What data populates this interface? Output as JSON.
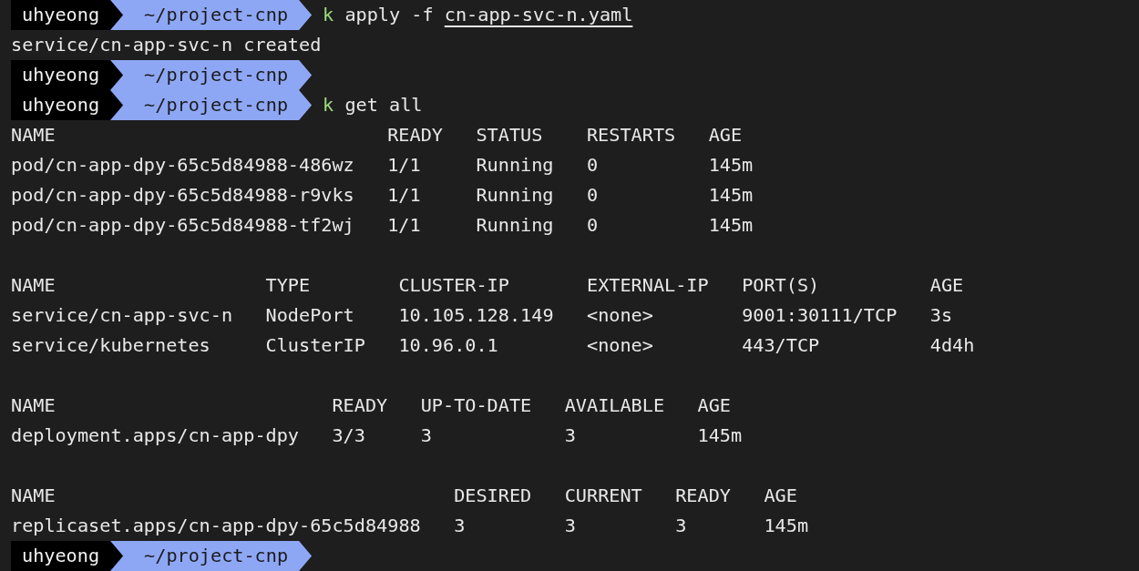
{
  "lines": [
    {
      "kind": "prompt",
      "user": "uhyeong",
      "path": "~/project-cnp",
      "command": "k",
      "args": [
        {
          "text": "apply -f",
          "underline": false
        },
        {
          "text": "cn-app-svc-n.yaml",
          "underline": true
        }
      ]
    },
    {
      "kind": "output",
      "text": "service/cn-app-svc-n created"
    },
    {
      "kind": "prompt",
      "user": "uhyeong",
      "path": "~/project-cnp"
    },
    {
      "kind": "prompt",
      "user": "uhyeong",
      "path": "~/project-cnp",
      "command": "k",
      "args": [
        {
          "text": "get all",
          "underline": false
        }
      ]
    },
    {
      "kind": "table",
      "columns": [
        "NAME",
        "READY",
        "STATUS",
        "RESTARTS",
        "AGE"
      ],
      "rows": [
        [
          "pod/cn-app-dpy-65c5d84988-486wz",
          "1/1",
          "Running",
          "0",
          "145m"
        ],
        [
          "pod/cn-app-dpy-65c5d84988-r9vks",
          "1/1",
          "Running",
          "0",
          "145m"
        ],
        [
          "pod/cn-app-dpy-65c5d84988-tf2wj",
          "1/1",
          "Running",
          "0",
          "145m"
        ]
      ]
    },
    {
      "kind": "table",
      "columns": [
        "NAME",
        "TYPE",
        "CLUSTER-IP",
        "EXTERNAL-IP",
        "PORT(S)",
        "AGE"
      ],
      "rows": [
        [
          "service/cn-app-svc-n",
          "NodePort",
          "10.105.128.149",
          "<none>",
          "9001:30111/TCP",
          "3s"
        ],
        [
          "service/kubernetes",
          "ClusterIP",
          "10.96.0.1",
          "<none>",
          "443/TCP",
          "4d4h"
        ]
      ]
    },
    {
      "kind": "table",
      "columns": [
        "NAME",
        "READY",
        "UP-TO-DATE",
        "AVAILABLE",
        "AGE"
      ],
      "rows": [
        [
          "deployment.apps/cn-app-dpy",
          "3/3",
          "3",
          "3",
          "145m"
        ]
      ]
    },
    {
      "kind": "table",
      "columns": [
        "NAME",
        "DESIRED",
        "CURRENT",
        "READY",
        "AGE"
      ],
      "rows": [
        [
          "replicaset.apps/cn-app-dpy-65c5d84988",
          "3",
          "3",
          "3",
          "145m"
        ]
      ]
    },
    {
      "kind": "prompt",
      "user": "uhyeong",
      "path": "~/project-cnp"
    }
  ]
}
